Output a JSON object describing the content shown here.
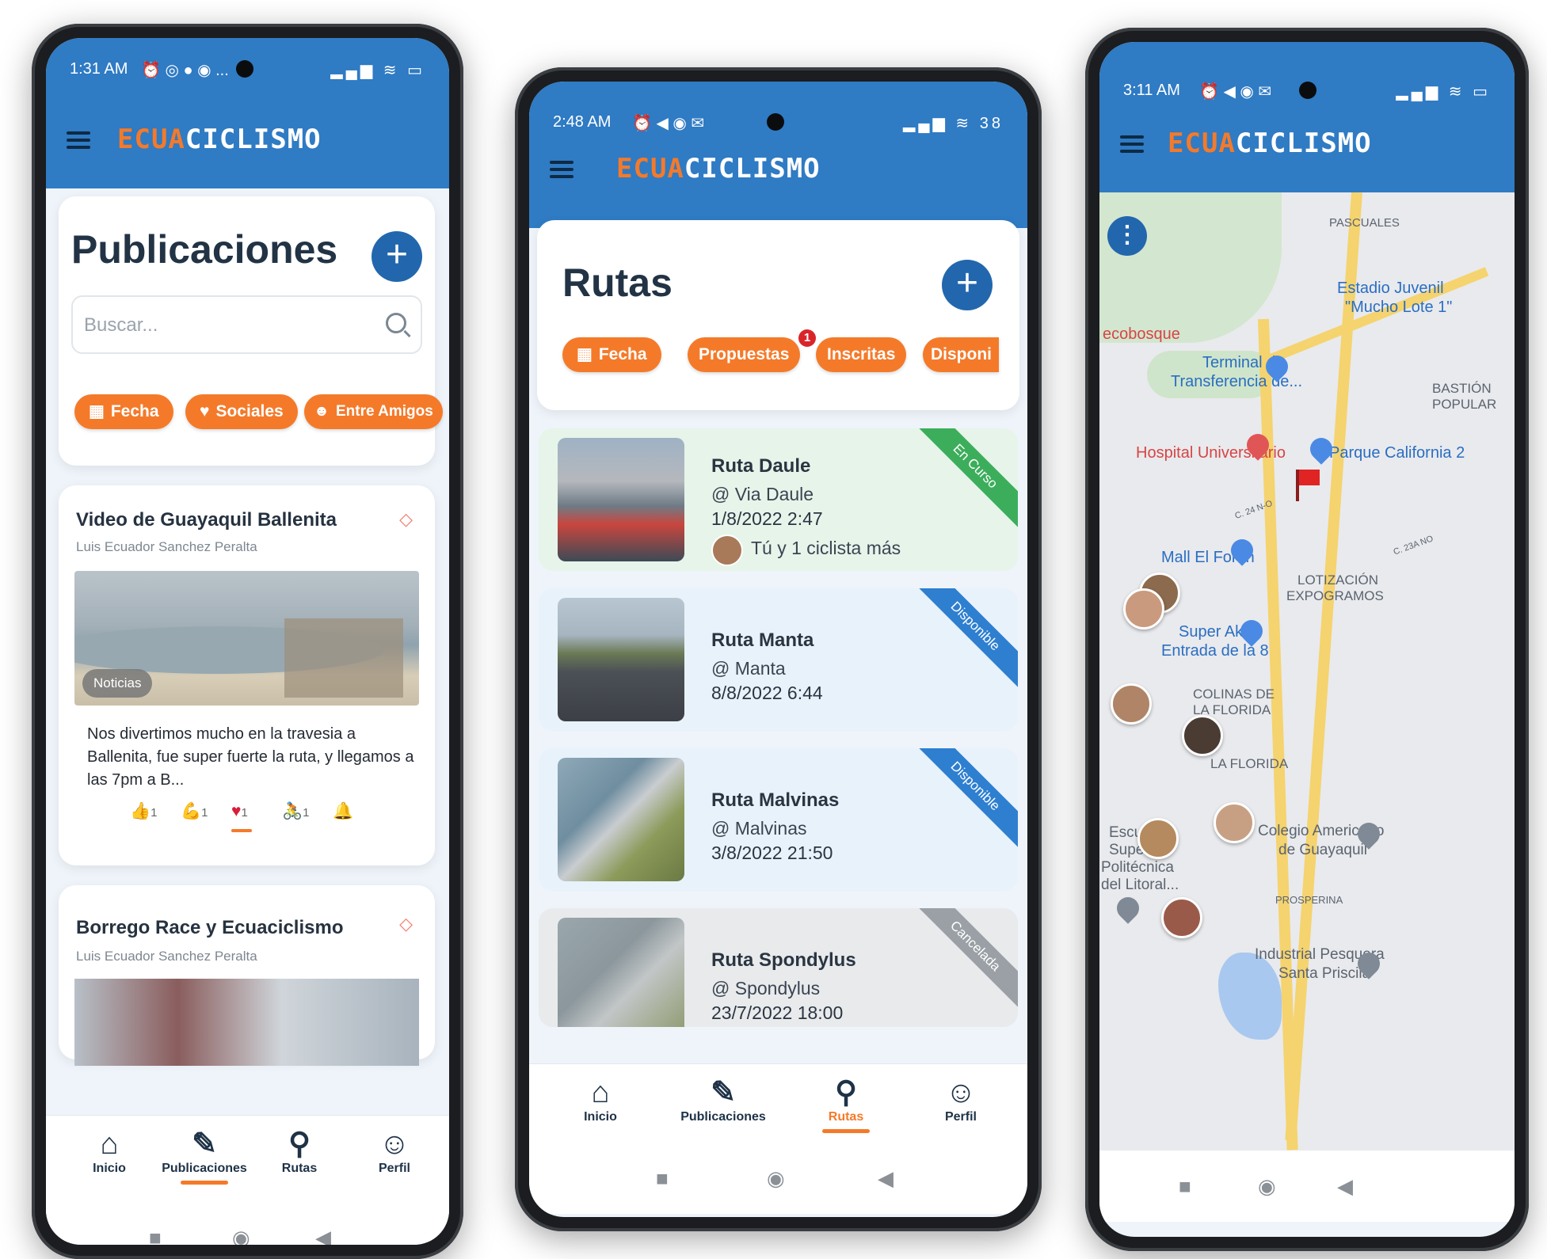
{
  "brand": {
    "part1": "ECUA",
    "part2": "CICLISMO"
  },
  "colors": {
    "appbar": "#2f7bc4",
    "accent": "#f47a2a",
    "fab": "#2267ad"
  },
  "phone1": {
    "time": "1:31 AM",
    "status_icons": "⏰ ◎ ● ◉ ...",
    "status_right": "▂▄▆ ≋ ▭",
    "title": "Publicaciones",
    "search_placeholder": "Buscar...",
    "chips": [
      {
        "icon": "calendar-icon",
        "glyph": "▦",
        "label": "Fecha"
      },
      {
        "icon": "heart-icon",
        "glyph": "♥",
        "label": "Sociales"
      },
      {
        "icon": "people-icon",
        "glyph": "☻",
        "label": "Entre Amigos"
      }
    ],
    "posts": [
      {
        "title": "Video de Guayaquil Ballenita",
        "author": "Luis Ecuador Sanchez Peralta",
        "image_tag": "Noticias",
        "text": "Nos divertimos mucho en la travesia a Ballenita, fue super fuerte la ruta, y llegamos a las 7pm a B...",
        "reactions": [
          {
            "icon": "thumbs-up-icon",
            "glyph": "👍",
            "count": "1"
          },
          {
            "icon": "muscle-icon",
            "glyph": "💪",
            "count": "1"
          },
          {
            "icon": "heart-icon",
            "glyph": "♥",
            "count": "1"
          },
          {
            "icon": "cyclist-icon",
            "glyph": "🚴",
            "count": "1"
          },
          {
            "icon": "bell-icon",
            "glyph": "🔔",
            "count": ""
          }
        ]
      },
      {
        "title": "Borrego Race y Ecuaciclismo",
        "author": "Luis Ecuador Sanchez Peralta"
      }
    ],
    "tabs": [
      {
        "icon": "home-icon",
        "glyph": "⌂",
        "label": "Inicio"
      },
      {
        "icon": "posts-icon",
        "glyph": "✎",
        "label": "Publicaciones"
      },
      {
        "icon": "bike-route-icon",
        "glyph": "⚲",
        "label": "Rutas"
      },
      {
        "icon": "profile-icon",
        "glyph": "☺",
        "label": "Perfil"
      }
    ],
    "active_tab": 1
  },
  "phone2": {
    "time": "2:48 AM",
    "status_icons": "⏰ ◀ ◉ ✉",
    "status_right": "▂▄▆ ≋ 38",
    "title": "Rutas",
    "chips": [
      {
        "icon": "calendar-icon",
        "glyph": "▦",
        "label": "Fecha"
      },
      {
        "icon": "",
        "glyph": "",
        "label": "Propuestas"
      },
      {
        "icon": "",
        "glyph": "",
        "label": "Inscritas"
      },
      {
        "icon": "",
        "glyph": "",
        "label": "Disponi"
      }
    ],
    "proposals_badge": "1",
    "routes": [
      {
        "name": "Ruta Daule",
        "location": "@ Via Daule",
        "date": "1/8/2022 2:47",
        "participants": "Tú y 1 ciclista más",
        "status": "En Curso",
        "status_color": "#3cae5b",
        "bg": "#e6f4ea"
      },
      {
        "name": "Ruta Manta",
        "location": "@ Manta",
        "date": "8/8/2022 6:44",
        "participants": "",
        "status": "Disponible",
        "status_color": "#2e7fd0",
        "bg": "#e8f2fb"
      },
      {
        "name": "Ruta Malvinas",
        "location": "@ Malvinas",
        "date": "3/8/2022 21:50",
        "participants": "",
        "status": "Disponible",
        "status_color": "#2e7fd0",
        "bg": "#e8f2fb"
      },
      {
        "name": "Ruta Spondylus",
        "location": "@ Spondylus",
        "date": "23/7/2022 18:00",
        "participants": "",
        "status": "Cancelada",
        "status_color": "#9aa0a6",
        "bg": "#e9eaec"
      }
    ],
    "tabs": [
      {
        "icon": "home-icon",
        "glyph": "⌂",
        "label": "Inicio"
      },
      {
        "icon": "posts-icon",
        "glyph": "✎",
        "label": "Publicaciones"
      },
      {
        "icon": "bike-route-icon",
        "glyph": "⚲",
        "label": "Rutas"
      },
      {
        "icon": "profile-icon",
        "glyph": "☺",
        "label": "Perfil"
      }
    ],
    "active_tab": 2
  },
  "phone3": {
    "time": "3:11 AM",
    "status_icons": "⏰ ◀ ◉ ✉",
    "status_right": "▂▄▆ ≋ ▭",
    "map_labels": [
      {
        "text": "PASCUALES",
        "kind": "area"
      },
      {
        "text": "Estadio Juvenil",
        "kind": "poi"
      },
      {
        "text": "\"Mucho Lote 1\"",
        "kind": "poi"
      },
      {
        "text": "ecobosque",
        "kind": "red"
      },
      {
        "text": "Terminal de",
        "kind": "poi"
      },
      {
        "text": "Transferencia de...",
        "kind": "poi"
      },
      {
        "text": "BASTIÓN",
        "kind": "area"
      },
      {
        "text": "POPULAR",
        "kind": "area"
      },
      {
        "text": "Hospital Universitario",
        "kind": "red"
      },
      {
        "text": "Parque California 2",
        "kind": "poi"
      },
      {
        "text": "Mall El Fortín",
        "kind": "poi"
      },
      {
        "text": "LOTIZACIÓN",
        "kind": "area"
      },
      {
        "text": "EXPOGRAMOS",
        "kind": "area"
      },
      {
        "text": "Super Aki -",
        "kind": "poi"
      },
      {
        "text": "Entrada de la 8",
        "kind": "poi"
      },
      {
        "text": "COLINAS DE",
        "kind": "area"
      },
      {
        "text": "LA FLORIDA",
        "kind": "area"
      },
      {
        "text": "LA FLORIDA",
        "kind": "area"
      },
      {
        "text": "Colegio Americano",
        "kind": "area"
      },
      {
        "text": "de Guayaquil",
        "kind": "area"
      },
      {
        "text": "Escue",
        "kind": "area"
      },
      {
        "text": "Super",
        "kind": "area"
      },
      {
        "text": "Politécnica",
        "kind": "area"
      },
      {
        "text": "del Litoral...",
        "kind": "area"
      },
      {
        "text": "PROSPERINA",
        "kind": "area"
      },
      {
        "text": "Industrial Pesquera",
        "kind": "area"
      },
      {
        "text": "Santa Priscila",
        "kind": "area"
      },
      {
        "text": "C. 24 N-O",
        "kind": "area"
      },
      {
        "text": "C. 23A NO",
        "kind": "area"
      }
    ]
  }
}
